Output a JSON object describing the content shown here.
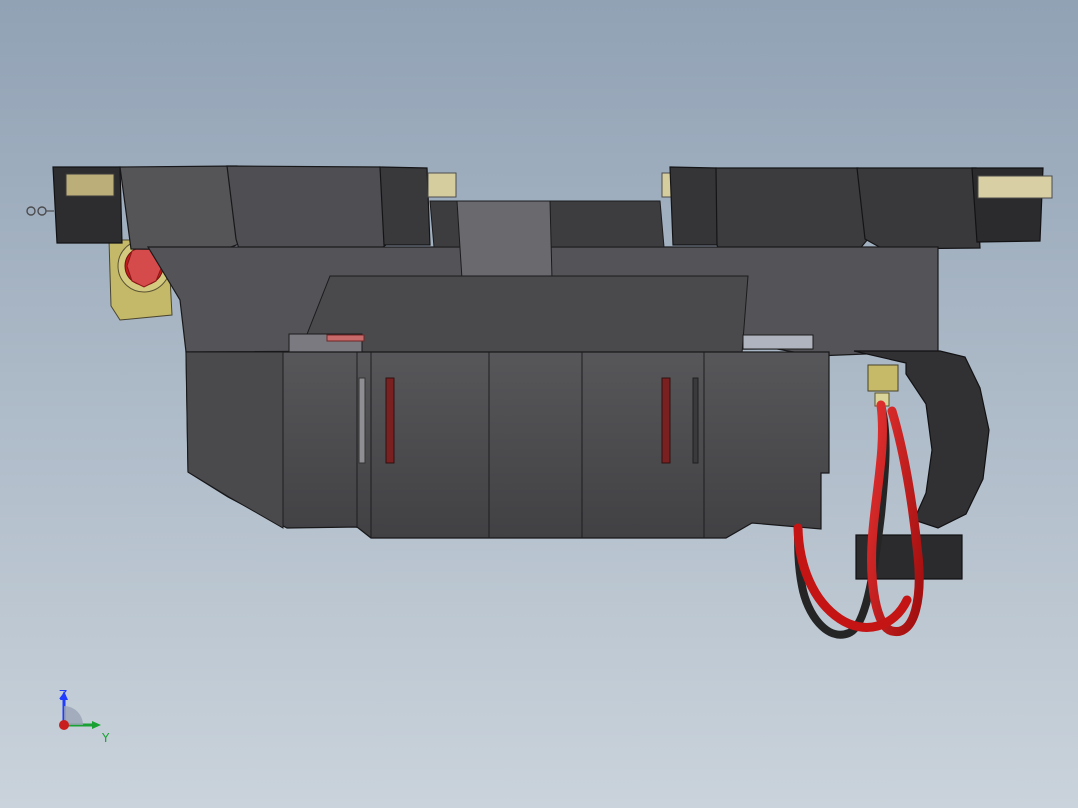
{
  "viewport": {
    "background_top": "#91a2b5",
    "background_bottom": "#cad3db"
  },
  "model": {
    "body_color": "#4c4c4f",
    "body_dark": "#2f2f31",
    "body_light": "#5a5a5e",
    "accent_red": "#c51d1d",
    "accent_tan": "#d8d0a4",
    "accent_yellow": "#d2c36a",
    "wire_red": "#c41414",
    "wire_black": "#252525"
  },
  "orientation_triad": {
    "z_label": "Z",
    "y_label": "Y",
    "z_color": "#1f3cff",
    "y_color": "#19a233",
    "origin_color": "#c81e1e"
  }
}
